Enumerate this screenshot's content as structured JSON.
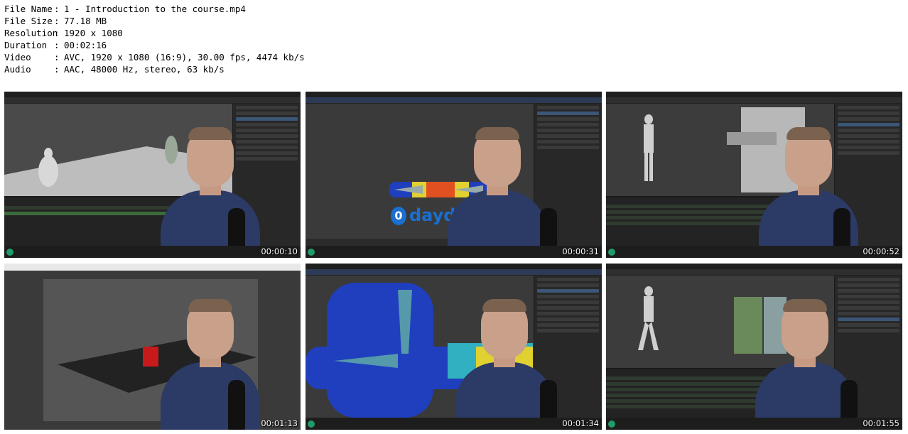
{
  "info": {
    "rows": [
      {
        "key": "File Name",
        "value": "1 - Introduction to the course.mp4"
      },
      {
        "key": "File Size",
        "value": "77.18 MB"
      },
      {
        "key": "Resolution",
        "value": "1920 x 1080"
      },
      {
        "key": "Duration",
        "value": "00:02:16"
      },
      {
        "key": "Video",
        "value": "AVC, 1920 x 1080 (16:9), 30.00 fps, 4474 kb/s"
      },
      {
        "key": "Audio",
        "value": "AAC, 48000 Hz, stereo, 63 kb/s"
      }
    ],
    "separator": ":"
  },
  "thumbnails": [
    {
      "timestamp": "00:00:10"
    },
    {
      "timestamp": "00:00:31"
    },
    {
      "timestamp": "00:00:52"
    },
    {
      "timestamp": "00:01:13"
    },
    {
      "timestamp": "00:01:34"
    },
    {
      "timestamp": "00:01:55"
    }
  ],
  "watermark": {
    "text": "daydown.com",
    "glyph": "0"
  },
  "colors": {
    "watermark": "#1a6fd1",
    "shirt": "#2c3a66",
    "blender_bg": "#2b2b2b"
  }
}
